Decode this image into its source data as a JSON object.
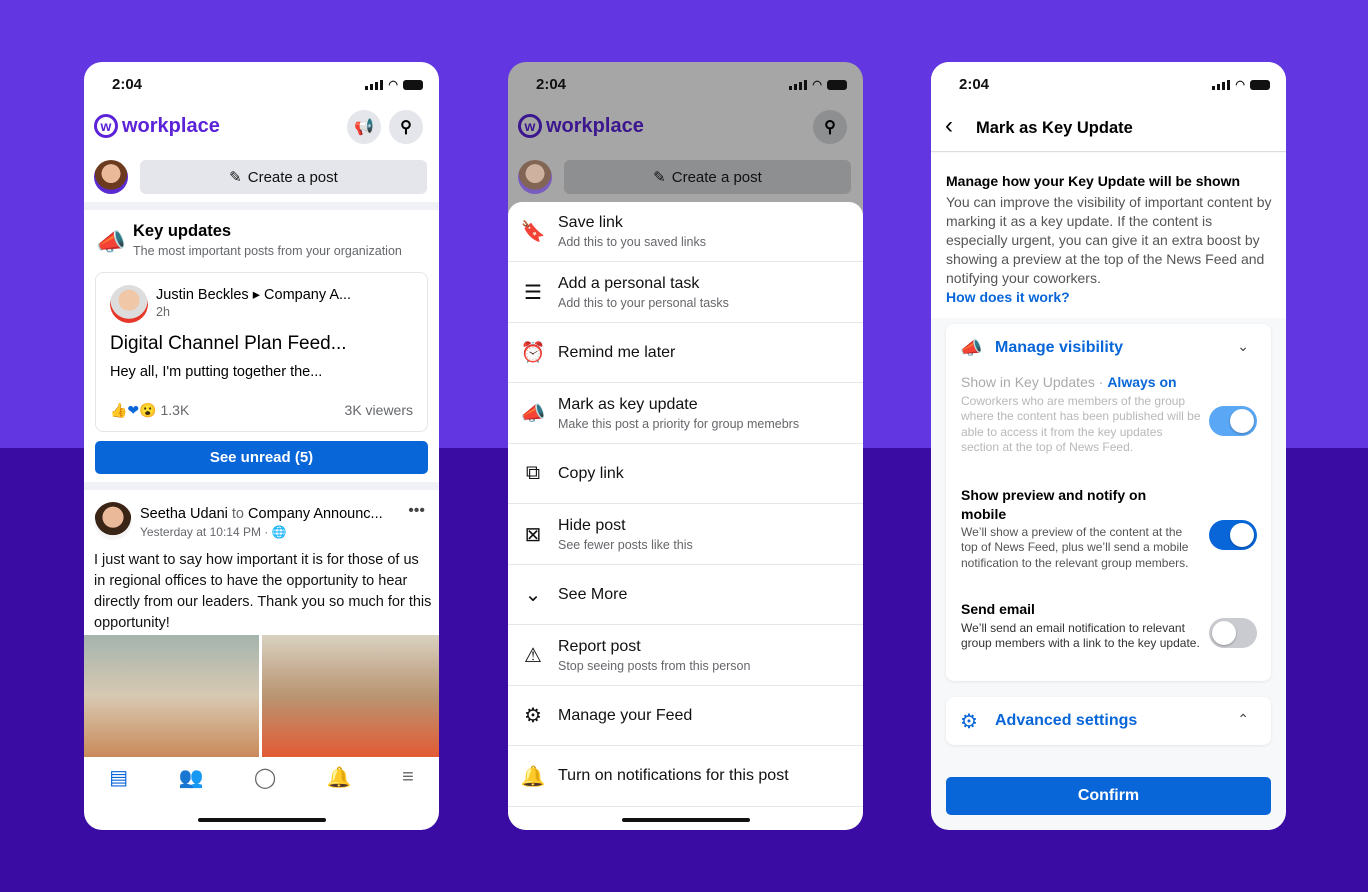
{
  "colors": {
    "bg_top": "#6236e0",
    "bg_bottom": "#3a0ca3",
    "accent": "#0866d9",
    "brand": "#5b22d8"
  },
  "time": "2:04",
  "feed": {
    "logo": "workplace",
    "create_post": "Create a post",
    "key_updates_title": "Key updates",
    "key_updates_subtitle": "The most important posts from your organization",
    "card": {
      "author": "Justin Beckles",
      "group": "Company A...",
      "time": "2h",
      "title": "Digital Channel Plan Feed...",
      "snippet": "Hey all, I'm putting together the...",
      "reactions": "1.3K",
      "viewers": "3K viewers"
    },
    "see_unread": "See unread (5)",
    "post": {
      "author": "Seetha Udani",
      "to": "to",
      "group": "Company Announc...",
      "time": "Yesterday at 10:14 PM · ",
      "text": "I just want to say how important it is for those of us in regional offices to have the opportunity to hear directly from our leaders. Thank you so much for this opportunity!"
    },
    "nav": [
      "news-feed-icon",
      "groups-icon",
      "chat-icon",
      "bell-icon",
      "menu-icon"
    ]
  },
  "menu": {
    "logo": "workplace",
    "create_post": "Create a post",
    "items": [
      {
        "icon": "bookmark-icon",
        "glyph": "🔖",
        "label": "Save link",
        "sub": "Add this to you saved links"
      },
      {
        "icon": "list-icon",
        "glyph": "☰",
        "label": "Add a personal task",
        "sub": "Add this to your personal tasks"
      },
      {
        "icon": "clock-icon",
        "glyph": "⏰",
        "label": "Remind me later",
        "sub": ""
      },
      {
        "icon": "megaphone-icon",
        "glyph": "📣",
        "label": "Mark as key update",
        "sub": "Make this post a priority for group memebrs"
      },
      {
        "icon": "copy-icon",
        "glyph": "⧉",
        "label": "Copy link",
        "sub": ""
      },
      {
        "icon": "hide-icon",
        "glyph": "⊠",
        "label": "Hide post",
        "sub": "See fewer posts like this"
      },
      {
        "icon": "chevron-down-icon",
        "glyph": "⌄",
        "label": "See More",
        "sub": ""
      },
      {
        "icon": "report-icon",
        "glyph": "⚠",
        "label": "Report post",
        "sub": "Stop seeing posts from this person"
      },
      {
        "icon": "sliders-icon",
        "glyph": "⚙",
        "label": "Manage your Feed",
        "sub": ""
      },
      {
        "icon": "bell-icon",
        "glyph": "🔔",
        "label": "Turn on notifications for this post",
        "sub": ""
      }
    ]
  },
  "key": {
    "title": "Mark as Key Update",
    "heading": "Manage how your Key Update will be shown",
    "intro": "You can improve the visibility of important content by marking it as a key update. If the content is especially urgent, you can give it an extra boost by showing a preview at the top of the News Feed and notifying your coworkers.",
    "how": "How does it work?",
    "visibility": "Manage visibility",
    "opt1": {
      "label": "Show in Key Updates",
      "sep": " · ",
      "always": "Always on",
      "desc": "Coworkers who are members of the group where the content has been published will be able to access it from the key updates section at the top of News Feed.",
      "on": true
    },
    "opt2": {
      "label": "Show preview and notify on mobile",
      "desc": "We’ll show a preview of the content at the top of News Feed, plus we’ll send a mobile notification to the relevant group members.",
      "on": true
    },
    "opt3": {
      "label": "Send email",
      "desc": "We’ll send an email notification to relevant group members with a link to the key update.",
      "on": false
    },
    "advanced": "Advanced settings",
    "confirm": "Confirm"
  }
}
